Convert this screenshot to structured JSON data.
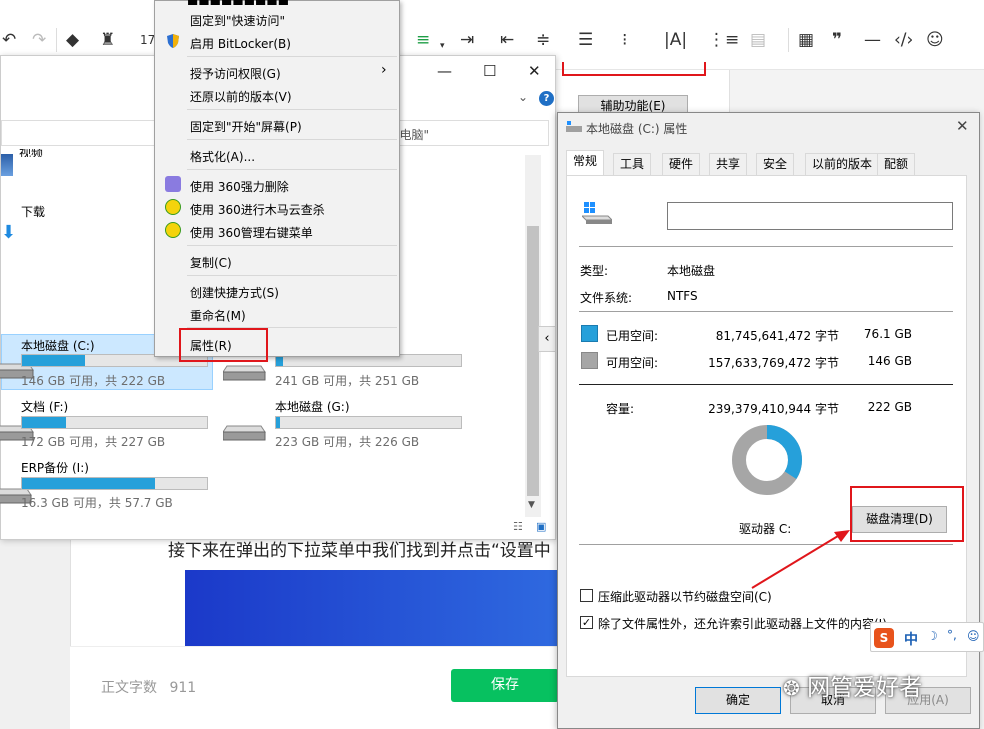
{
  "editor": {
    "toolbar_font_size": "17",
    "article_text": "接下来在弹出的下拉菜单中我们找到并点击“设置中",
    "word_count_label": "正文字数",
    "word_count_value": "911",
    "save_label": "保存"
  },
  "explorer": {
    "addr_hint": "索\"此电脑\"",
    "folders": [
      {
        "label": "视频"
      },
      {
        "label": "下载"
      }
    ],
    "drives": [
      {
        "name": "本地磁盘 (C:)",
        "space": "146 GB 可用，共 222 GB",
        "used_fraction": 0.34
      },
      {
        "name": "",
        "space": "241 GB 可用，共 251 GB",
        "used_fraction": 0.04
      },
      {
        "name": "文档 (F:)",
        "space": "172 GB 可用，共 227 GB",
        "used_fraction": 0.24
      },
      {
        "name": "本地磁盘 (G:)",
        "space": "223 GB 可用，共 226 GB",
        "used_fraction": 0.02
      },
      {
        "name": "ERP备份 (I:)",
        "space": "16.3 GB 可用，共 57.7 GB",
        "used_fraction": 0.72
      }
    ]
  },
  "context_menu": {
    "items": [
      "固定到\"快速访问\"",
      "启用 BitLocker(B)",
      "授予访问权限(G)",
      "还原以前的版本(V)",
      "固定到\"开始\"屏幕(P)",
      "格式化(A)...",
      "使用 360强力删除",
      "使用 360进行木马云查杀",
      "使用 360管理右键菜单",
      "复制(C)",
      "创建快捷方式(S)",
      "重命名(M)",
      "属性(R)"
    ]
  },
  "bg_button": "辅助功能(E)",
  "properties": {
    "title": "本地磁盘 (C:) 属性",
    "tabs": [
      "常规",
      "工具",
      "硬件",
      "共享",
      "安全",
      "以前的版本",
      "配额"
    ],
    "label_input": "",
    "type_label": "类型:",
    "type_value": "本地磁盘",
    "fs_label": "文件系统:",
    "fs_value": "NTFS",
    "used_label": "已用空间:",
    "used_bytes": "81,745,641,472 字节",
    "used_size": "76.1 GB",
    "free_label": "可用空间:",
    "free_bytes": "157,633,769,472 字节",
    "free_size": "146 GB",
    "cap_label": "容量:",
    "cap_bytes": "239,379,410,944 字节",
    "cap_size": "222 GB",
    "used_fraction": 0.341,
    "drive_label": "驱动器 C:",
    "cleanup_label": "磁盘清理(D)",
    "compress_label": "压缩此驱动器以节约磁盘空间(C)",
    "compress_checked": false,
    "index_label": "除了文件属性外，还允许索引此驱动器上文件的内容(I)",
    "index_checked": true,
    "ok_label": "确定",
    "cancel_label": "取消",
    "apply_label": "应用(A)",
    "colors": {
      "used": "#26a0da",
      "free": "#a6a6a6"
    }
  },
  "ime": {
    "lang": "中"
  },
  "watermark": "网管爱好者"
}
